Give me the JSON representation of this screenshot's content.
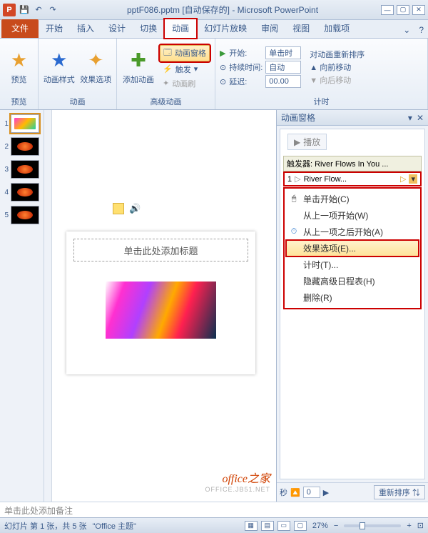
{
  "title": "pptF086.pptm [自动保存的] - Microsoft PowerPoint",
  "tabs": {
    "file": "文件",
    "home": "开始",
    "insert": "插入",
    "design": "设计",
    "transitions": "切换",
    "animations": "动画",
    "slideshow": "幻灯片放映",
    "review": "审阅",
    "view": "视图",
    "addins": "加载项"
  },
  "ribbon": {
    "preview": "预览",
    "preview_grp": "预览",
    "anim_style": "动画样式",
    "effect_opts": "效果选项",
    "anim_grp": "动画",
    "add_anim": "添加动画",
    "anim_pane": "动画窗格",
    "trigger": "触发 ",
    "anim_painter": "动画刷",
    "adv_grp": "高级动画",
    "start_lbl": "开始:",
    "start_val": "单击时",
    "duration_lbl": "持续时间:",
    "duration_val": "自动",
    "delay_lbl": "延迟:",
    "delay_val": "00.00",
    "timing_grp": "计时",
    "reorder_hdr": "对动画重新排序",
    "move_earlier": "向前移动",
    "move_later": "向后移动"
  },
  "slide": {
    "title_ph": "单击此处添加标题"
  },
  "pane": {
    "title": "动画窗格",
    "play": "播放",
    "trigger_hdr": "触发器: River Flows In You ...",
    "item_num": "1",
    "item_name": "River Flow...",
    "menu": {
      "click": "单击开始(C)",
      "with_prev": "从上一项开始(W)",
      "after_prev": "从上一项之后开始(A)",
      "effect": "效果选项(E)...",
      "timing": "计时(T)...",
      "hide": "隐藏高级日程表(H)",
      "remove": "删除(R)"
    },
    "seconds": "秒",
    "sec_val": "0",
    "reorder": "重新排序"
  },
  "notes": "单击此处添加备注",
  "status": {
    "slide": "幻灯片 第 1 张，共 5 张",
    "theme": "\"Office 主题\"",
    "zoom": "27%"
  },
  "watermark": {
    "l1": "office之家",
    "l2": "OFFICE.JB51.NET"
  },
  "thumbs": [
    "1",
    "2",
    "3",
    "4",
    "5"
  ]
}
